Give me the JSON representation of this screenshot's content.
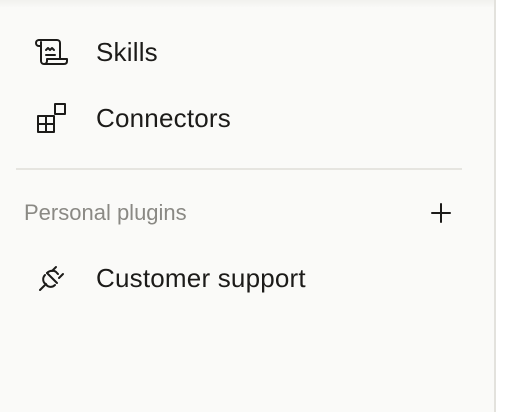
{
  "nav": {
    "items": [
      {
        "label": "Skills",
        "icon": "scroll-icon"
      },
      {
        "label": "Connectors",
        "icon": "blocks-icon"
      }
    ]
  },
  "personal_plugins": {
    "title": "Personal plugins",
    "add_icon": "plus-icon",
    "items": [
      {
        "label": "Customer support",
        "icon": "plug-icon"
      }
    ]
  },
  "colors": {
    "background": "#fafaf8",
    "text": "#1c1b19",
    "muted_text": "#8a8984",
    "divider": "#e6e5e0"
  }
}
